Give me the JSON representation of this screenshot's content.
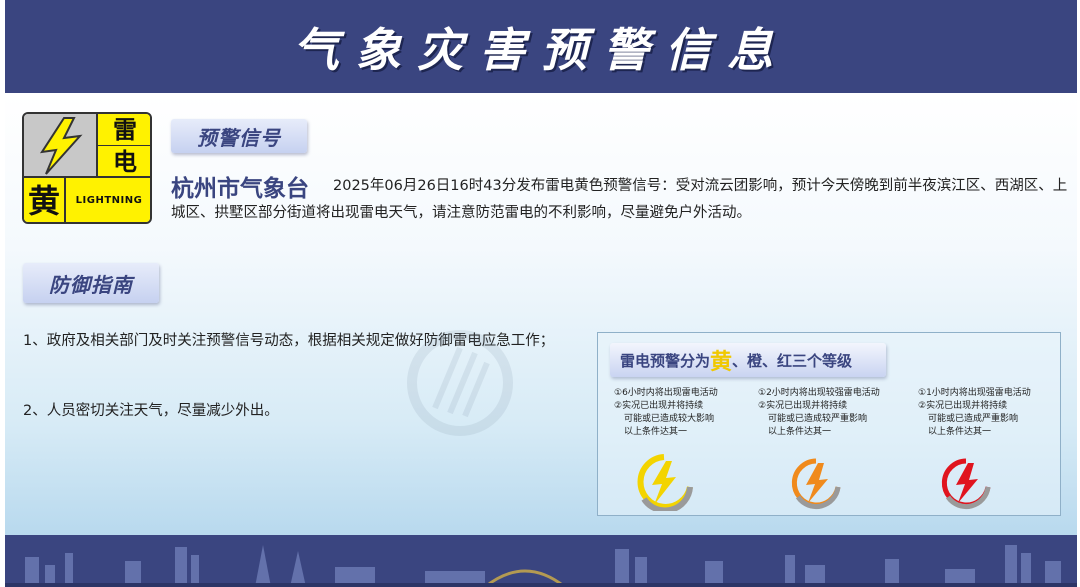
{
  "header": {
    "title": "气象灾害预警信息"
  },
  "warning_icon": {
    "char1": "雷",
    "char2": "电",
    "level": "黄",
    "english": "LIGHTNING"
  },
  "signal_section": {
    "tab_label": "预警信号"
  },
  "alert": {
    "issuer": "杭州市气象台",
    "text": "2025年06月26日16时43分发布雷电黄色预警信号：受对流云团影响，预计今天傍晚到前半夜滨江区、西湖区、上城区、拱墅区部分街道将出现雷电天气，请注意防范雷电的不利影响，尽量避免户外活动。"
  },
  "guide_section": {
    "tab_label": "防御指南",
    "items": [
      "1、政府及相关部门及时关注预警信号动态，根据相关规定做好防御雷电应急工作；",
      "2、人员密切关注天气，尽量减少外出。"
    ]
  },
  "levels": {
    "banner_prefix": "雷电预警分为",
    "banner_highlight": "黄",
    "banner_suffix": "、橙、红三个等级",
    "yellow": {
      "line1": "①6小时内将出现雷电活动",
      "line2": "②实况已出现并将持续",
      "line3": "可能或已造成较大影响",
      "line4": "以上条件达其一",
      "color": "#f3d400"
    },
    "orange": {
      "line1": "①2小时内将出现较强雷电活动",
      "line2": "②实况已出现并将持续",
      "line3": "可能或已造成较严重影响",
      "line4": "以上条件达其一",
      "color": "#f08a1c"
    },
    "red": {
      "line1": "①1小时内将出现强雷电活动",
      "line2": "②实况已出现并将持续",
      "line3": "可能或已造成严重影响",
      "line4": "以上条件达其一",
      "color": "#e0141e"
    }
  },
  "colors": {
    "brand": "#3a4580",
    "warning_yellow": "#fff200"
  }
}
